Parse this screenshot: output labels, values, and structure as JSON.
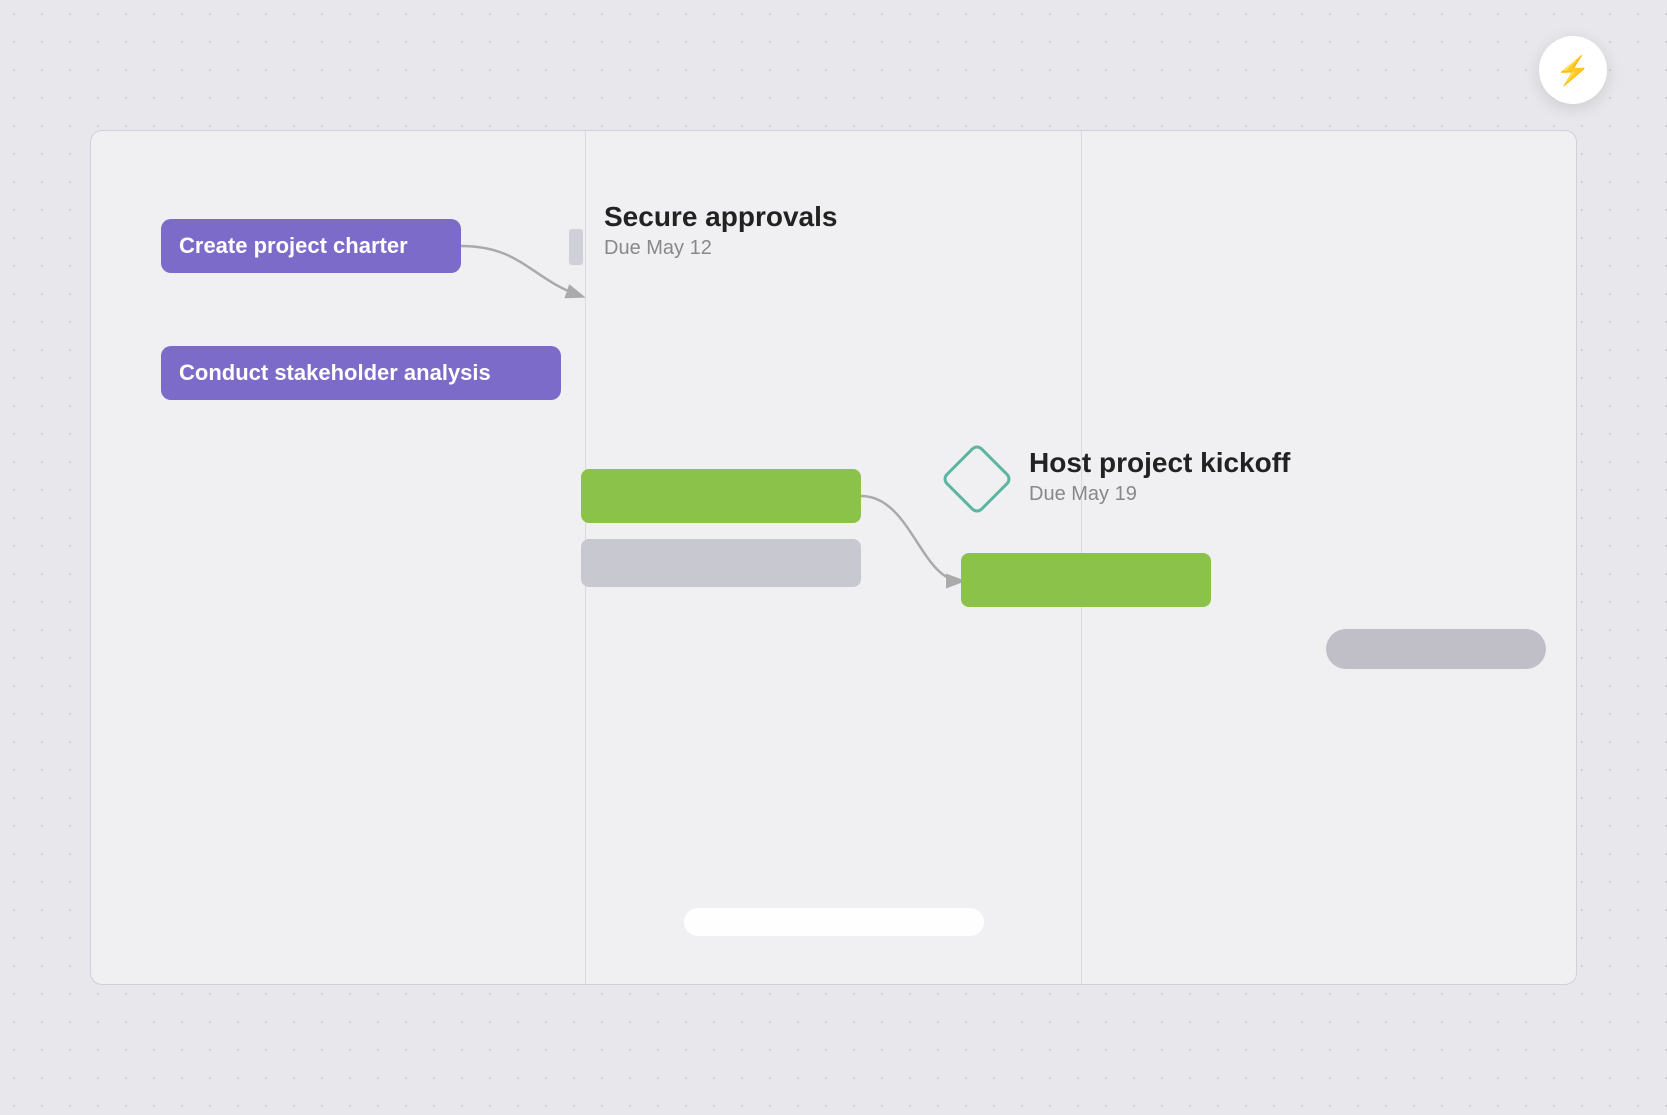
{
  "flash_button": {
    "aria_label": "Flash / AI",
    "icon": "⚡"
  },
  "tasks": {
    "create_charter": {
      "label": "Create project charter"
    },
    "stakeholder_analysis": {
      "label": "Conduct stakeholder analysis"
    },
    "secure_approvals": {
      "title": "Secure approvals",
      "due": "Due May 12"
    },
    "host_kickoff": {
      "title": "Host project kickoff",
      "due": "Due May 19"
    }
  },
  "scrollbar": {}
}
